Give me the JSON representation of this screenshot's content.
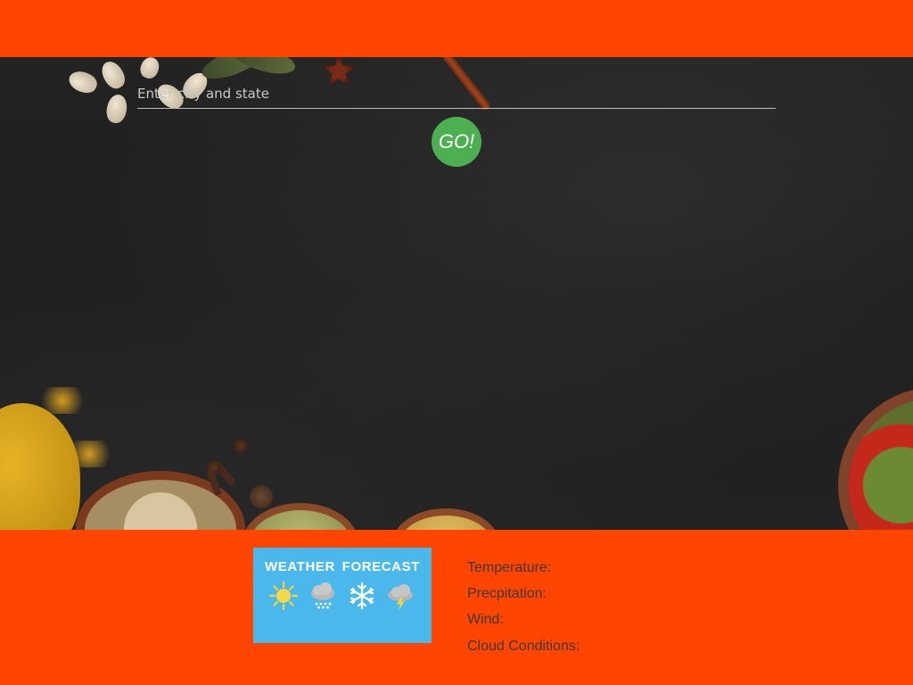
{
  "search": {
    "placeholder": "Enter city and state",
    "go_label": "GO!"
  },
  "forecast_card": {
    "title": "WEATHER  FORECAST",
    "icons": [
      "sun-icon",
      "rain-cloud-icon",
      "snowflake-icon",
      "storm-cloud-icon"
    ]
  },
  "info": {
    "temperature_label": "Temperature:",
    "precipitation_label": "Precpitation:",
    "wind_label": "Wind:",
    "cloud_label": "Cloud Conditions:"
  },
  "colors": {
    "accent": "#ff4500",
    "go_button": "#4caf50",
    "card": "#4bb8ec"
  }
}
